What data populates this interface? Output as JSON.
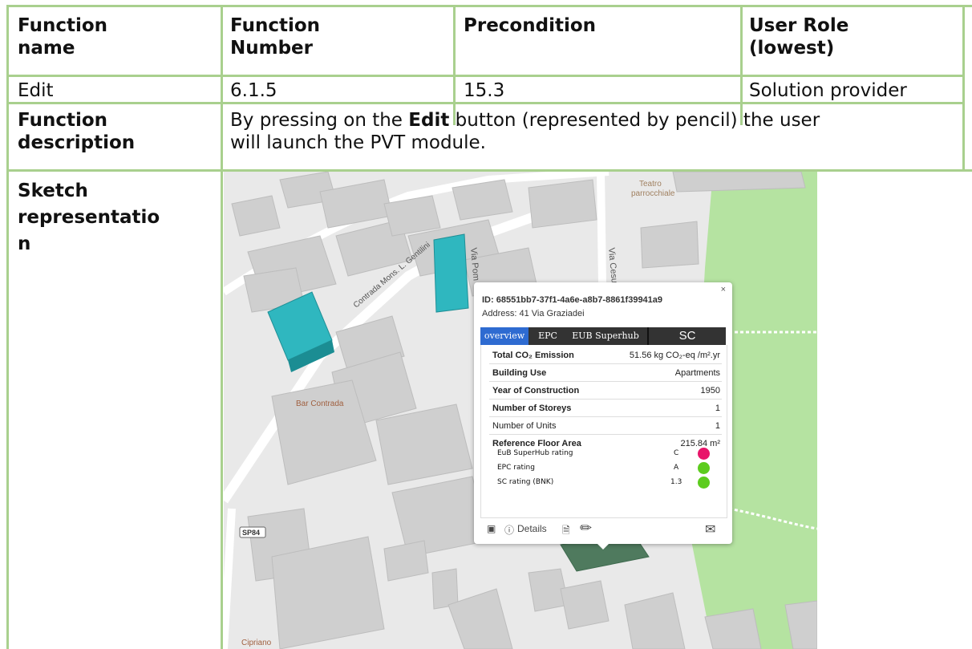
{
  "table": {
    "headers": [
      "Function name",
      "Function Number",
      "Precondition",
      "User Role (lowest)"
    ],
    "header_lines": {
      "c1": [
        "Function",
        "name"
      ],
      "c2": [
        "Function",
        "Number"
      ],
      "c3": [
        "Precondition"
      ],
      "c4": [
        "User Role",
        "(lowest)"
      ]
    },
    "values": {
      "name": "Edit",
      "number": "6.1.5",
      "precondition": "15.3",
      "role": "Solution provider"
    },
    "description": {
      "label_lines": [
        "Function",
        "description"
      ],
      "line1_pre": "By pressing on the ",
      "line1_bold": "Edit",
      "line1_post": " button (represented by pencil) the user",
      "line2": "will launch the PVT module."
    },
    "sketch": {
      "label_lines": [
        "Sketch",
        "representatio",
        "n"
      ]
    }
  },
  "map": {
    "labels": {
      "street1": "Contrada Mons. L. Gentilini",
      "street2": "Via Pom",
      "street3": "Via Cesu",
      "teatro": "Teatro",
      "parrocchiale": "parrocchiale",
      "bar": "Bar Contrada",
      "road": "SP84",
      "cipriano": "Cipriano"
    },
    "colors": {
      "land": "#e9e9e9",
      "building": "#cfcfcf",
      "park": "#b5e3a1",
      "selected": "#2fb7bf",
      "road": "#ffffff"
    }
  },
  "popup": {
    "close": "×",
    "id_label": "ID: 68551bb7-37f1-4a6e-a8b7-8861f39941a9",
    "address": "Address: 41  Via Graziadei",
    "tabs": [
      "overview",
      "EPC",
      "EUB Superhub",
      "SC"
    ],
    "rows": [
      {
        "label": "Total CO₂ Emission",
        "value": "51.56 kg CO₂-eq /m².yr"
      },
      {
        "label": "Building Use",
        "value": "Apartments"
      },
      {
        "label": "Year of Construction",
        "value": "1950"
      },
      {
        "label": "Number of Storeys",
        "value": "1"
      },
      {
        "label": "Number of Units",
        "value": "1"
      },
      {
        "label": "Reference Floor Area",
        "value": "215.84 m²"
      }
    ],
    "ratings": [
      {
        "label": "EuB SuperHub rating",
        "value": "C",
        "color": "#e8156a"
      },
      {
        "label": "EPC rating",
        "value": "A",
        "color": "#5ccc1e"
      },
      {
        "label": "SC rating (BNK)",
        "value": "1.3",
        "color": "#5ccc1e"
      }
    ],
    "toolbar": {
      "details": "Details"
    },
    "icons": [
      "image-icon",
      "info-icon",
      "document-icon",
      "pencil-icon",
      "mail-icon"
    ]
  }
}
